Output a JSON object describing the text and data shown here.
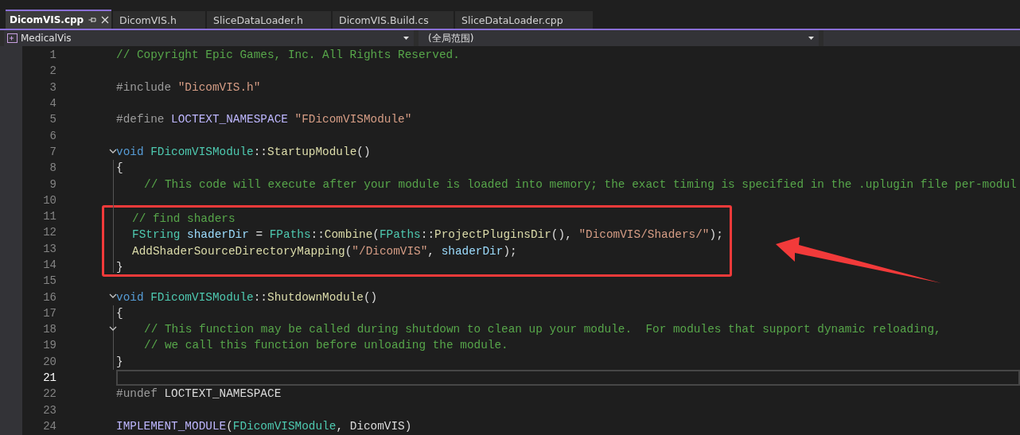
{
  "tabs": [
    {
      "label": "DicomVIS.cpp",
      "selected": true
    },
    {
      "label": "DicomVIS.h",
      "selected": false
    },
    {
      "label": "SliceDataLoader.h",
      "selected": false
    },
    {
      "label": "DicomVIS.Build.cs",
      "selected": false
    },
    {
      "label": "SliceDataLoader.cpp",
      "selected": false
    }
  ],
  "navigation": {
    "project": "MedicalVis",
    "scope": "(全局范围)"
  },
  "lines": [
    {
      "number": "1",
      "tokens": [
        {
          "text": "// Copyright Epic Games, Inc. All Rights Reserved.",
          "kind": "comment"
        }
      ]
    },
    {
      "number": "2"
    },
    {
      "number": "3",
      "tokens": [
        {
          "text": "#include ",
          "kind": "preproc"
        },
        {
          "text": "\"DicomVIS.h\"",
          "kind": "string"
        }
      ]
    },
    {
      "number": "4"
    },
    {
      "number": "5",
      "tokens": [
        {
          "text": "#define ",
          "kind": "preproc"
        },
        {
          "text": "LOCTEXT_NAMESPACE",
          "kind": "macro"
        },
        {
          "text": " \"FDicomVISModule\"",
          "kind": "string"
        }
      ]
    },
    {
      "number": "6"
    },
    {
      "number": "7",
      "foldable": true,
      "tokens": [
        {
          "text": "void",
          "kind": "keyword"
        },
        {
          "text": " FDicomVISModule",
          "kind": "type"
        },
        {
          "text": "::",
          "kind": "plain"
        },
        {
          "text": "StartupModule",
          "kind": "function"
        },
        {
          "text": "()",
          "kind": "plain"
        }
      ]
    },
    {
      "number": "8",
      "guide": true,
      "tokens": [
        {
          "text": "{",
          "kind": "plain"
        }
      ]
    },
    {
      "number": "9",
      "guide": true,
      "indented": true,
      "tokens": [
        {
          "text": "// This code will execute after your module is loaded into memory; the exact timing is specified in the .uplugin file per-modul",
          "kind": "comment"
        }
      ]
    },
    {
      "number": "10",
      "guide": true
    },
    {
      "number": "11",
      "guide": true,
      "indented": true,
      "boxed": true,
      "tokens": [
        {
          "text": "// find shaders",
          "kind": "comment"
        }
      ]
    },
    {
      "number": "12",
      "guide": true,
      "indented": true,
      "boxed": true,
      "tokens": [
        {
          "text": "FString",
          "kind": "type"
        },
        {
          "text": " shaderDir",
          "kind": "variable"
        },
        {
          "text": " = ",
          "kind": "plain"
        },
        {
          "text": "FPaths",
          "kind": "type"
        },
        {
          "text": "::",
          "kind": "plain"
        },
        {
          "text": "Combine",
          "kind": "function"
        },
        {
          "text": "(",
          "kind": "plain"
        },
        {
          "text": "FPaths",
          "kind": "type"
        },
        {
          "text": "::",
          "kind": "plain"
        },
        {
          "text": "ProjectPluginsDir",
          "kind": "function"
        },
        {
          "text": "(), ",
          "kind": "plain"
        },
        {
          "text": "\"DicomVIS/Shaders/\"",
          "kind": "string"
        },
        {
          "text": ");",
          "kind": "plain"
        }
      ]
    },
    {
      "number": "13",
      "guide": true,
      "indented": true,
      "boxed": true,
      "tokens": [
        {
          "text": "AddShaderSourceDirectoryMapping",
          "kind": "function"
        },
        {
          "text": "(",
          "kind": "plain"
        },
        {
          "text": "\"/DicomVIS\"",
          "kind": "string"
        },
        {
          "text": ", ",
          "kind": "plain"
        },
        {
          "text": "shaderDir",
          "kind": "variable"
        },
        {
          "text": ");",
          "kind": "plain"
        }
      ]
    },
    {
      "number": "14",
      "guide": true,
      "boxed": true,
      "tokens": [
        {
          "text": "}",
          "kind": "plain"
        }
      ]
    },
    {
      "number": "15"
    },
    {
      "number": "16",
      "foldable": true,
      "tokens": [
        {
          "text": "void",
          "kind": "keyword"
        },
        {
          "text": " FDicomVISModule",
          "kind": "type"
        },
        {
          "text": "::",
          "kind": "plain"
        },
        {
          "text": "ShutdownModule",
          "kind": "function"
        },
        {
          "text": "()",
          "kind": "plain"
        }
      ]
    },
    {
      "number": "17",
      "guide": true,
      "tokens": [
        {
          "text": "{",
          "kind": "plain"
        }
      ]
    },
    {
      "number": "18",
      "guide": true,
      "foldable": true,
      "indented": true,
      "tokens": [
        {
          "text": "// This function may be called during shutdown to clean up your module.  For modules that support dynamic reloading,",
          "kind": "comment"
        }
      ]
    },
    {
      "number": "19",
      "guide": true,
      "indented": true,
      "tokens": [
        {
          "text": "// we call this function before unloading the module.",
          "kind": "comment"
        }
      ]
    },
    {
      "number": "20",
      "guide": true,
      "tokens": [
        {
          "text": "}",
          "kind": "plain"
        }
      ]
    },
    {
      "number": "21",
      "current": true
    },
    {
      "number": "22",
      "tokens": [
        {
          "text": "#undef ",
          "kind": "preproc"
        },
        {
          "text": "LOCTEXT_NAMESPACE",
          "kind": "plain"
        }
      ]
    },
    {
      "number": "23"
    },
    {
      "number": "24",
      "tokens": [
        {
          "text": "IMPLEMENT_MODULE",
          "kind": "macro"
        },
        {
          "text": "(",
          "kind": "plain"
        },
        {
          "text": "FDicomVISModule",
          "kind": "type"
        },
        {
          "text": ", DicomVIS)",
          "kind": "plain"
        }
      ]
    }
  ]
}
